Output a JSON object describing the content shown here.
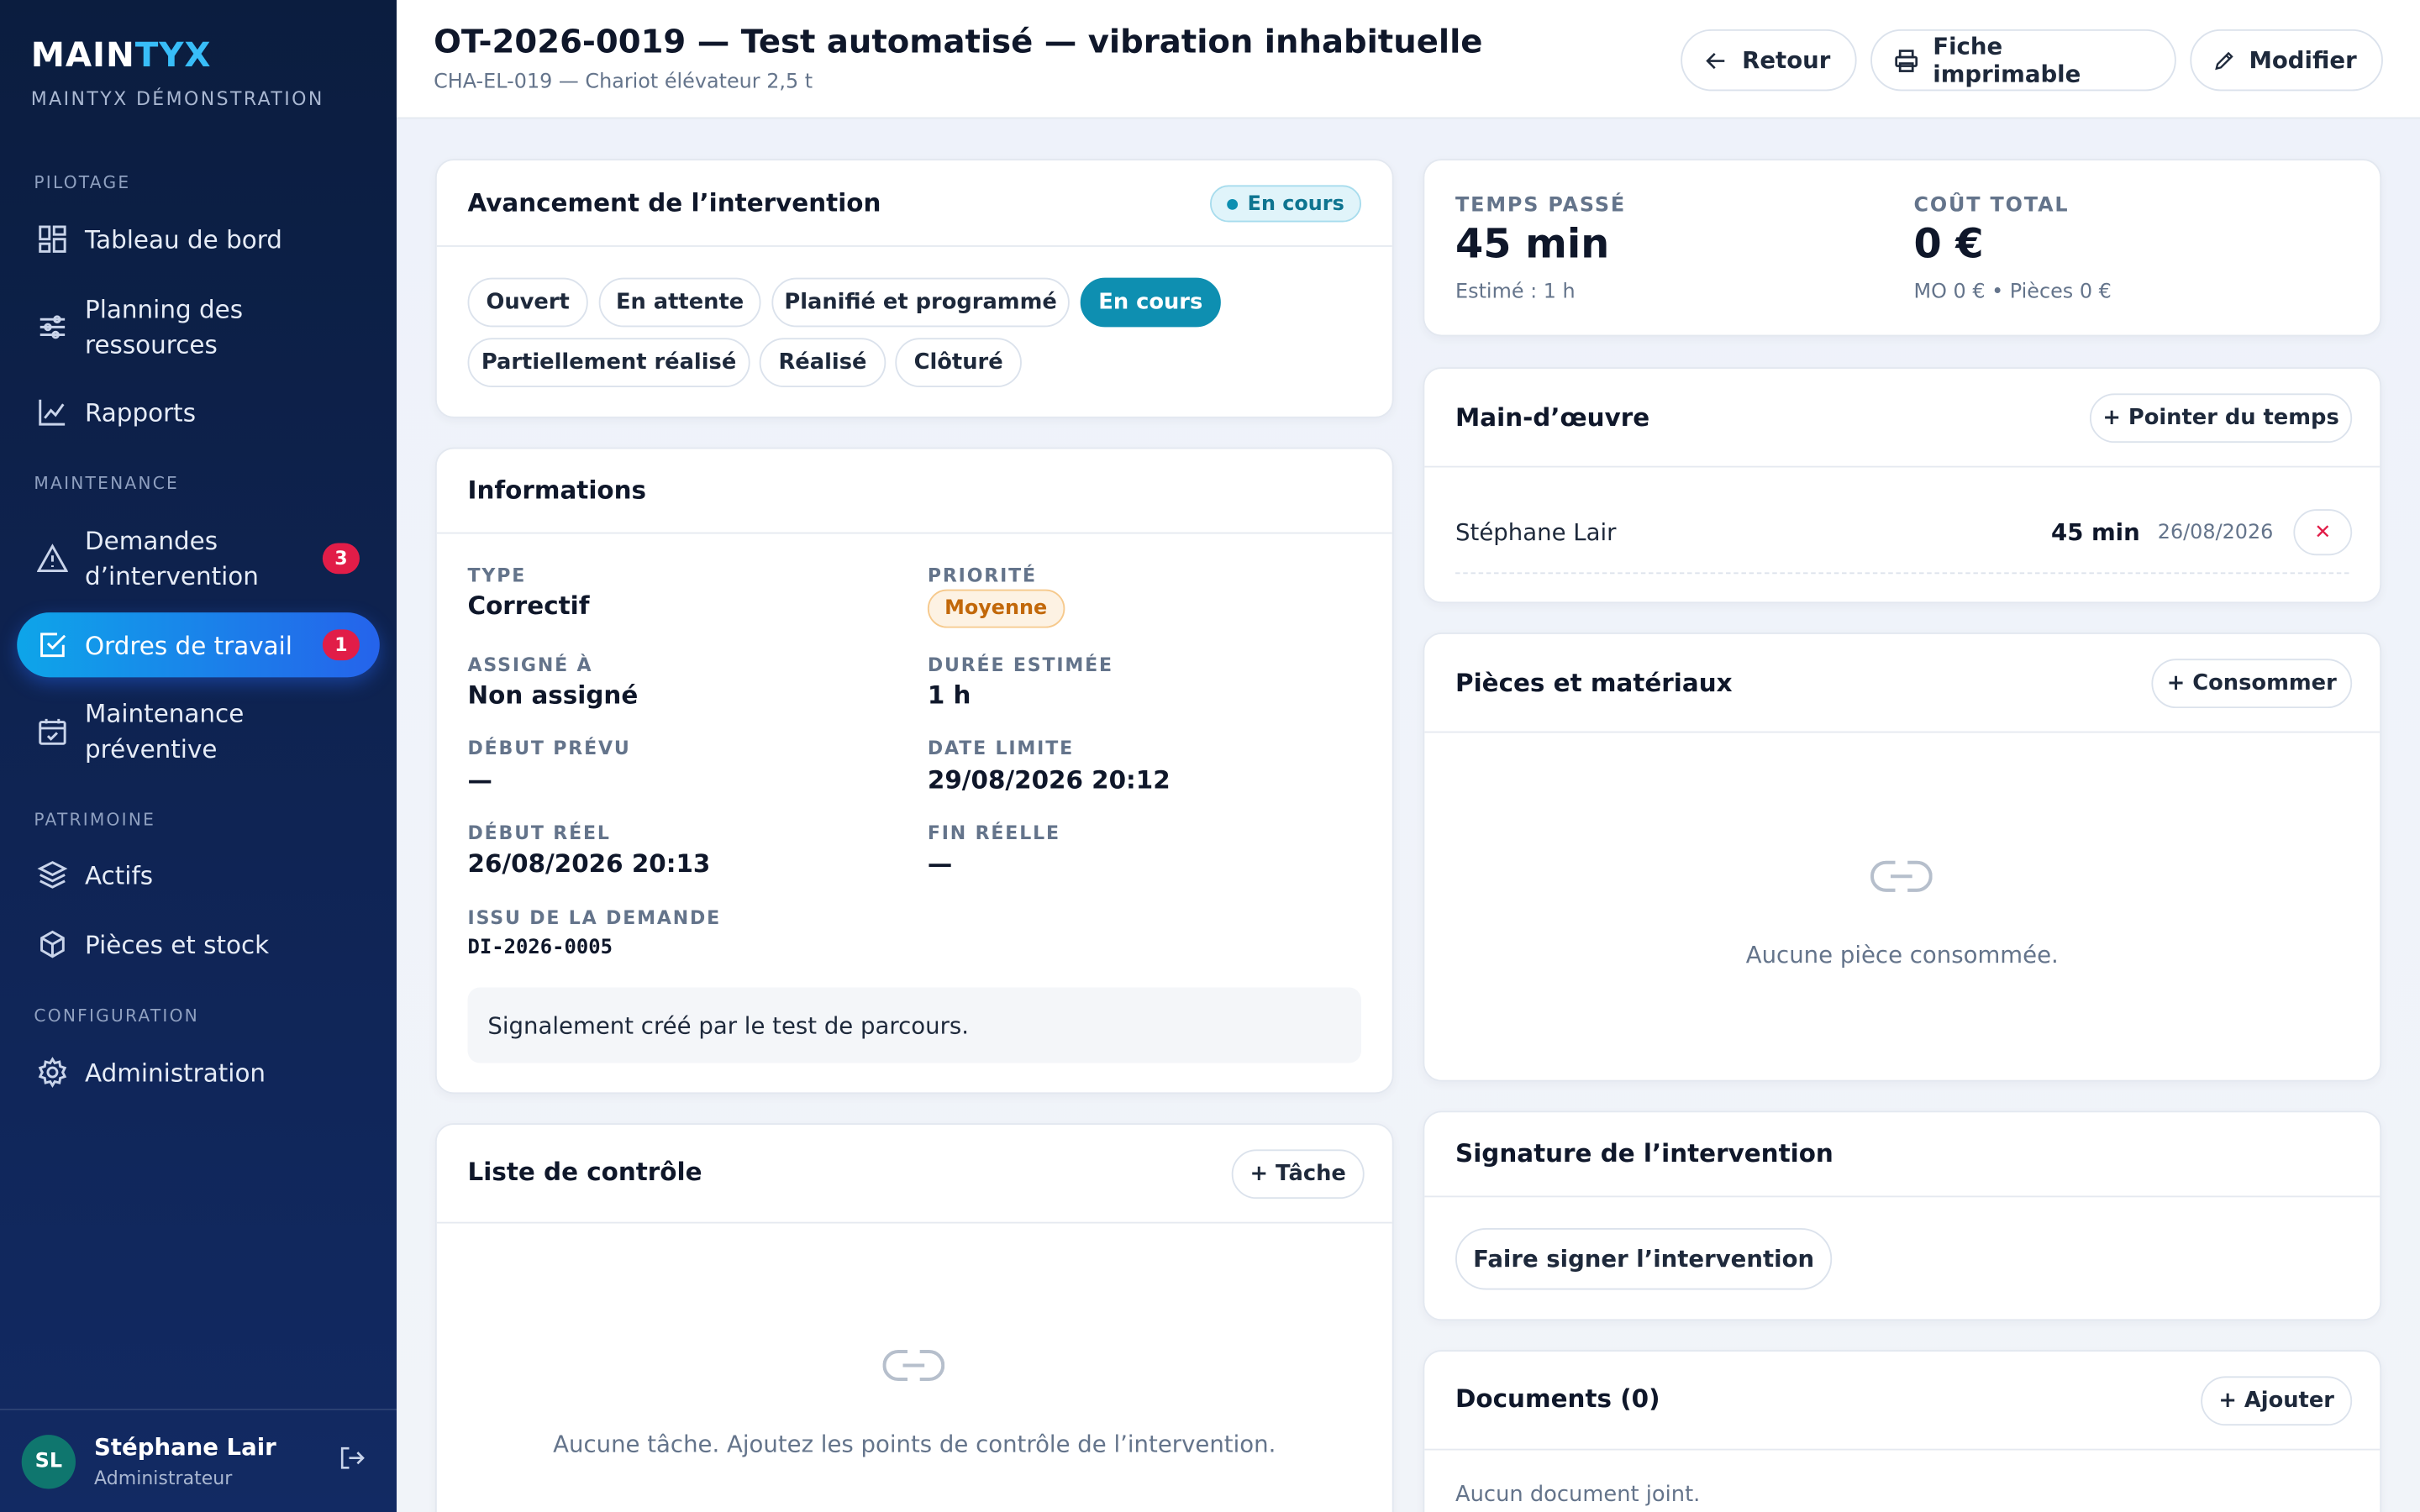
{
  "brand": {
    "part1": "MAIN",
    "part2": "TYX",
    "subtitle": "MAINTYX DÉMONSTRATION"
  },
  "sidebar": {
    "sections": {
      "pilotage": "PILOTAGE",
      "maintenance": "MAINTENANCE",
      "patrimoine": "PATRIMOINE",
      "configuration": "CONFIGURATION"
    },
    "items": [
      {
        "label": "Tableau de bord",
        "icon": "dashboard-icon"
      },
      {
        "label": "Planning des ressources",
        "icon": "sliders-icon"
      },
      {
        "label": "Rapports",
        "icon": "chart-icon"
      },
      {
        "label": "Demandes d’intervention",
        "icon": "warning-icon",
        "badge": "3"
      },
      {
        "label": "Ordres de travail",
        "icon": "checkbox-icon",
        "badge": "1",
        "active": true
      },
      {
        "label": "Maintenance préventive",
        "icon": "calendar-icon"
      },
      {
        "label": "Actifs",
        "icon": "layers-icon"
      },
      {
        "label": "Pièces et stock",
        "icon": "box-icon"
      },
      {
        "label": "Administration",
        "icon": "gear-icon"
      }
    ],
    "user": {
      "initials": "SL",
      "name": "Stéphane Lair",
      "role": "Administrateur"
    }
  },
  "header": {
    "title": "OT-2026-0019 — Test automatisé — vibration inhabituelle",
    "subtitle": "CHA-EL-019 — Chariot élévateur 2,5 t",
    "buttons": {
      "back": "Retour",
      "print": "Fiche imprimable",
      "edit": "Modifier"
    }
  },
  "progress": {
    "title": "Avancement de l’intervention",
    "status": "En cours",
    "steps": [
      "Ouvert",
      "En attente",
      "Planifié et programmé",
      "En cours",
      "Partiellement réalisé",
      "Réalisé",
      "Clôturé"
    ],
    "active_step": "En cours"
  },
  "info": {
    "title": "Informations",
    "type_label": "TYPE",
    "type": "Correctif",
    "priority_label": "PRIORITÉ",
    "priority": "Moyenne",
    "assigned_label": "ASSIGNÉ À",
    "assigned": "Non assigné",
    "duration_label": "DURÉE ESTIMÉE",
    "duration": "1 h",
    "planned_start_label": "DÉBUT PRÉVU",
    "planned_start": "—",
    "deadline_label": "DATE LIMITE",
    "deadline": "29/08/2026 20:12",
    "actual_start_label": "DÉBUT RÉEL",
    "actual_start": "26/08/2026 20:13",
    "actual_end_label": "FIN RÉELLE",
    "actual_end": "—",
    "request_label": "ISSU DE LA DEMANDE",
    "request": "DI-2026-0005",
    "note": "Signalement créé par le test de parcours."
  },
  "checklist": {
    "title": "Liste de contrôle",
    "add": "+ Tâche",
    "empty": "Aucune tâche. Ajoutez les points de contrôle de l’intervention."
  },
  "stats": {
    "time_label": "TEMPS PASSÉ",
    "time": "45 min",
    "time_sub": "Estimé : 1 h",
    "cost_label": "COÛT TOTAL",
    "cost": "0 €",
    "cost_sub": "MO 0 € • Pièces 0 €"
  },
  "labor": {
    "title": "Main-d’œuvre",
    "add": "+ Pointer du temps",
    "entries": [
      {
        "name": "Stéphane Lair",
        "duration": "45 min",
        "date": "26/08/2026"
      }
    ]
  },
  "parts": {
    "title": "Pièces et matériaux",
    "add": "+ Consommer",
    "empty": "Aucune pièce consommée."
  },
  "signature": {
    "title": "Signature de l’intervention",
    "button": "Faire signer l’intervention"
  },
  "documents": {
    "title": "Documents (0)",
    "add": "+ Ajouter",
    "empty": "Aucun document joint."
  }
}
